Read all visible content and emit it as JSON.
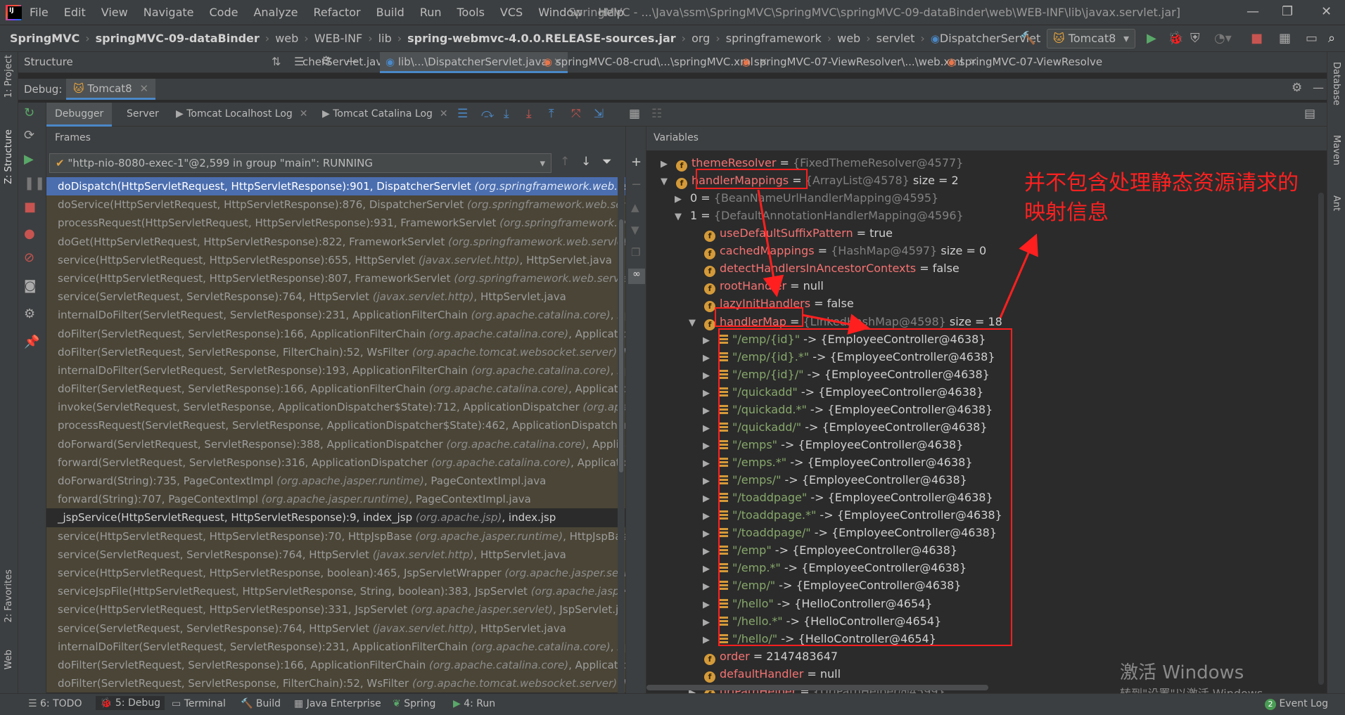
{
  "menu": {
    "items": [
      "File",
      "Edit",
      "View",
      "Navigate",
      "Code",
      "Analyze",
      "Refactor",
      "Build",
      "Run",
      "Tools",
      "VCS",
      "Window",
      "Help"
    ],
    "window_title": "SpringMVC - ...\\Java\\ssm\\SpringMVC\\SpringMVC\\springMVC-09-dataBinder\\web\\WEB-INF\\lib\\javax.servlet.jar]"
  },
  "breadcrumbs": [
    "SpringMVC",
    "springMVC-09-dataBinder",
    "web",
    "WEB-INF",
    "lib",
    "spring-webmvc-4.0.0.RELEASE-sources.jar",
    "org",
    "springframework",
    "web",
    "servlet",
    "DispatcherServlet"
  ],
  "run_config": "Tomcat8",
  "structure_panel": {
    "title": "Structure"
  },
  "editor_tabs": [
    {
      "label": "cherServlet.java",
      "active": false
    },
    {
      "label": "lib\\...\\DispatcherServlet.java",
      "active": true
    },
    {
      "label": "springMVC-08-crud\\...\\springMVC.xml",
      "active": false
    },
    {
      "label": "springMVC-07-ViewResolver\\...\\web.xml",
      "active": false
    },
    {
      "label": "springMVC-07-ViewResolve",
      "active": false
    }
  ],
  "debug": {
    "label": "Debug:",
    "session": "Tomcat8",
    "tabs": [
      "Debugger",
      "Server",
      "Tomcat Localhost Log",
      "Tomcat Catalina Log"
    ],
    "frames_label": "Frames",
    "variables_label": "Variables",
    "thread": "\"http-nio-8080-exec-1\"@2,599 in group \"main\": RUNNING"
  },
  "frames": [
    {
      "m": "doDispatch(HttpServletRequest, HttpServletResponse):901, DispatcherServlet ",
      "p": "(org.springframework.web.servlet)",
      "f": "",
      "kind": "sel"
    },
    {
      "m": "doService(HttpServletRequest, HttpServletResponse):876, DispatcherServlet ",
      "p": "(org.springframework.web.servlet)",
      "f": "",
      "kind": "lib"
    },
    {
      "m": "processRequest(HttpServletRequest, HttpServletResponse):931, FrameworkServlet ",
      "p": "(org.springframework.web.servlet)",
      "f": "",
      "kind": "lib"
    },
    {
      "m": "doGet(HttpServletRequest, HttpServletResponse):822, FrameworkServlet ",
      "p": "(org.springframework.web.servlet)",
      "f": ", F",
      "kind": "lib"
    },
    {
      "m": "service(HttpServletRequest, HttpServletResponse):655, HttpServlet ",
      "p": "(javax.servlet.http)",
      "f": ", HttpServlet.java",
      "kind": "lib"
    },
    {
      "m": "service(HttpServletRequest, HttpServletResponse):807, FrameworkServlet ",
      "p": "(org.springframework.web.servlet)",
      "f": ", F",
      "kind": "lib"
    },
    {
      "m": "service(ServletRequest, ServletResponse):764, HttpServlet ",
      "p": "(javax.servlet.http)",
      "f": ", HttpServlet.java",
      "kind": "lib"
    },
    {
      "m": "internalDoFilter(ServletRequest, ServletResponse):231, ApplicationFilterChain ",
      "p": "(org.apache.catalina.core)",
      "f": ", Appli",
      "kind": "lib"
    },
    {
      "m": "doFilter(ServletRequest, ServletResponse):166, ApplicationFilterChain ",
      "p": "(org.apache.catalina.core)",
      "f": ", ApplicationFil",
      "kind": "lib"
    },
    {
      "m": "doFilter(ServletRequest, ServletResponse, FilterChain):52, WsFilter ",
      "p": "(org.apache.tomcat.websocket.server)",
      "f": ", WsF",
      "kind": "lib"
    },
    {
      "m": "internalDoFilter(ServletRequest, ServletResponse):193, ApplicationFilterChain ",
      "p": "(org.apache.catalina.core)",
      "f": ", Appli",
      "kind": "lib"
    },
    {
      "m": "doFilter(ServletRequest, ServletResponse):166, ApplicationFilterChain ",
      "p": "(org.apache.catalina.core)",
      "f": ", ApplicationFil",
      "kind": "lib"
    },
    {
      "m": "invoke(ServletRequest, ServletResponse, ApplicationDispatcher$State):712, ApplicationDispatcher ",
      "p": "(org.apache",
      "f": "",
      "kind": "lib"
    },
    {
      "m": "processRequest(ServletRequest, ServletResponse, ApplicationDispatcher$State):462, ApplicationDispatcher ",
      "p": "(o",
      "f": "",
      "kind": "lib"
    },
    {
      "m": "doForward(ServletRequest, ServletResponse):388, ApplicationDispatcher ",
      "p": "(org.apache.catalina.core)",
      "f": ", Applicatio",
      "kind": "lib"
    },
    {
      "m": "forward(ServletRequest, ServletResponse):316, ApplicationDispatcher ",
      "p": "(org.apache.catalina.core)",
      "f": ", ApplicationDi",
      "kind": "lib"
    },
    {
      "m": "doForward(String):735, PageContextImpl ",
      "p": "(org.apache.jasper.runtime)",
      "f": ", PageContextImpl.java",
      "kind": "lib"
    },
    {
      "m": "forward(String):707, PageContextImpl ",
      "p": "(org.apache.jasper.runtime)",
      "f": ", PageContextImpl.java",
      "kind": "lib"
    },
    {
      "m": "_jspService(HttpServletRequest, HttpServletResponse):9, index_jsp ",
      "p": "(org.apache.jsp)",
      "f": ", index.jsp",
      "kind": "own"
    },
    {
      "m": "service(HttpServletRequest, HttpServletResponse):70, HttpJspBase ",
      "p": "(org.apache.jasper.runtime)",
      "f": ", HttpJspBase.ja",
      "kind": "lib"
    },
    {
      "m": "service(ServletRequest, ServletResponse):764, HttpServlet ",
      "p": "(javax.servlet.http)",
      "f": ", HttpServlet.java",
      "kind": "lib"
    },
    {
      "m": "service(HttpServletRequest, HttpServletResponse, boolean):465, JspServletWrapper ",
      "p": "(org.apache.jasper.servle",
      "f": "",
      "kind": "lib"
    },
    {
      "m": "serviceJspFile(HttpServletRequest, HttpServletResponse, String, boolean):383, JspServlet ",
      "p": "(org.apache.jasper.se",
      "f": "",
      "kind": "lib"
    },
    {
      "m": "service(HttpServletRequest, HttpServletResponse):331, JspServlet ",
      "p": "(org.apache.jasper.servlet)",
      "f": ", JspServlet.java",
      "kind": "lib"
    },
    {
      "m": "service(ServletRequest, ServletResponse):764, HttpServlet ",
      "p": "(javax.servlet.http)",
      "f": ", HttpServlet.java",
      "kind": "lib"
    },
    {
      "m": "internalDoFilter(ServletRequest, ServletResponse):231, ApplicationFilterChain ",
      "p": "(org.apache.catalina.core)",
      "f": ", Appli",
      "kind": "lib"
    },
    {
      "m": "doFilter(ServletRequest, ServletResponse):166, ApplicationFilterChain ",
      "p": "(org.apache.catalina.core)",
      "f": ", ApplicationFil",
      "kind": "lib"
    },
    {
      "m": "doFilter(ServletRequest, ServletResponse, FilterChain):52, WsFilter ",
      "p": "(org.apache.tomcat.websocket.server)",
      "f": ", WsF",
      "kind": "lib"
    }
  ],
  "variables": [
    {
      "tri": "▶",
      "icon": "f",
      "name": "themeResolver",
      "eq": " = ",
      "val": "{FixedThemeResolver@4577}",
      "extra": "",
      "indent": 0
    },
    {
      "tri": "▼",
      "icon": "f",
      "name": "handlerMappings",
      "eq": " = ",
      "val": "{ArrayList@4578}",
      "extra": "  size = 2",
      "indent": 0
    },
    {
      "tri": "▶",
      "icon": "",
      "name": "0",
      "eq": " = ",
      "val": "{BeanNameUrlHandlerMapping@4595}",
      "extra": "",
      "indent": 1,
      "plainname": true
    },
    {
      "tri": "▼",
      "icon": "",
      "name": "1",
      "eq": " = ",
      "val": "{DefaultAnnotationHandlerMapping@4596}",
      "extra": "",
      "indent": 1,
      "plainname": true
    },
    {
      "tri": "",
      "icon": "f",
      "name": "useDefaultSuffixPattern",
      "eq": " = ",
      "val": "",
      "extra": "true",
      "indent": 2
    },
    {
      "tri": "",
      "icon": "f",
      "name": "cachedMappings",
      "eq": " = ",
      "val": "{HashMap@4597}",
      "extra": "  size = 0",
      "indent": 2
    },
    {
      "tri": "",
      "icon": "f",
      "name": "detectHandlersInAncestorContexts",
      "eq": " = ",
      "val": "",
      "extra": "false",
      "indent": 2
    },
    {
      "tri": "",
      "icon": "f",
      "name": "rootHandler",
      "eq": " = ",
      "val": "",
      "extra": "null",
      "indent": 2
    },
    {
      "tri": "",
      "icon": "f",
      "name": "lazyInitHandlers",
      "eq": " = ",
      "val": "",
      "extra": "false",
      "indent": 2
    },
    {
      "tri": "▼",
      "icon": "f",
      "name": "handlerMap",
      "eq": " = ",
      "val": "{LinkedHashMap@4598}",
      "extra": "  size = 18",
      "indent": 2
    },
    {
      "tri": "▶",
      "icon": "l",
      "name": "\"/emp/{id}\"",
      "eq": " -> ",
      "val": "",
      "extra": "{EmployeeController@4638}",
      "indent": 3,
      "str": true
    },
    {
      "tri": "▶",
      "icon": "l",
      "name": "\"/emp/{id}.*\"",
      "eq": " -> ",
      "val": "",
      "extra": "{EmployeeController@4638}",
      "indent": 3,
      "str": true
    },
    {
      "tri": "▶",
      "icon": "l",
      "name": "\"/emp/{id}/\"",
      "eq": " -> ",
      "val": "",
      "extra": "{EmployeeController@4638}",
      "indent": 3,
      "str": true
    },
    {
      "tri": "▶",
      "icon": "l",
      "name": "\"/quickadd\"",
      "eq": " -> ",
      "val": "",
      "extra": "{EmployeeController@4638}",
      "indent": 3,
      "str": true
    },
    {
      "tri": "▶",
      "icon": "l",
      "name": "\"/quickadd.*\"",
      "eq": " -> ",
      "val": "",
      "extra": "{EmployeeController@4638}",
      "indent": 3,
      "str": true
    },
    {
      "tri": "▶",
      "icon": "l",
      "name": "\"/quickadd/\"",
      "eq": " -> ",
      "val": "",
      "extra": "{EmployeeController@4638}",
      "indent": 3,
      "str": true
    },
    {
      "tri": "▶",
      "icon": "l",
      "name": "\"/emps\"",
      "eq": " -> ",
      "val": "",
      "extra": "{EmployeeController@4638}",
      "indent": 3,
      "str": true
    },
    {
      "tri": "▶",
      "icon": "l",
      "name": "\"/emps.*\"",
      "eq": " -> ",
      "val": "",
      "extra": "{EmployeeController@4638}",
      "indent": 3,
      "str": true
    },
    {
      "tri": "▶",
      "icon": "l",
      "name": "\"/emps/\"",
      "eq": " -> ",
      "val": "",
      "extra": "{EmployeeController@4638}",
      "indent": 3,
      "str": true
    },
    {
      "tri": "▶",
      "icon": "l",
      "name": "\"/toaddpage\"",
      "eq": " -> ",
      "val": "",
      "extra": "{EmployeeController@4638}",
      "indent": 3,
      "str": true
    },
    {
      "tri": "▶",
      "icon": "l",
      "name": "\"/toaddpage.*\"",
      "eq": " -> ",
      "val": "",
      "extra": "{EmployeeController@4638}",
      "indent": 3,
      "str": true
    },
    {
      "tri": "▶",
      "icon": "l",
      "name": "\"/toaddpage/\"",
      "eq": " -> ",
      "val": "",
      "extra": "{EmployeeController@4638}",
      "indent": 3,
      "str": true
    },
    {
      "tri": "▶",
      "icon": "l",
      "name": "\"/emp\"",
      "eq": " -> ",
      "val": "",
      "extra": "{EmployeeController@4638}",
      "indent": 3,
      "str": true
    },
    {
      "tri": "▶",
      "icon": "l",
      "name": "\"/emp.*\"",
      "eq": " -> ",
      "val": "",
      "extra": "{EmployeeController@4638}",
      "indent": 3,
      "str": true
    },
    {
      "tri": "▶",
      "icon": "l",
      "name": "\"/emp/\"",
      "eq": " -> ",
      "val": "",
      "extra": "{EmployeeController@4638}",
      "indent": 3,
      "str": true
    },
    {
      "tri": "▶",
      "icon": "l",
      "name": "\"/hello\"",
      "eq": " -> ",
      "val": "",
      "extra": "{HelloController@4654}",
      "indent": 3,
      "str": true
    },
    {
      "tri": "▶",
      "icon": "l",
      "name": "\"/hello.*\"",
      "eq": " -> ",
      "val": "",
      "extra": "{HelloController@4654}",
      "indent": 3,
      "str": true
    },
    {
      "tri": "▶",
      "icon": "l",
      "name": "\"/hello/\"",
      "eq": " -> ",
      "val": "",
      "extra": "{HelloController@4654}",
      "indent": 3,
      "str": true
    },
    {
      "tri": "",
      "icon": "f",
      "name": "order",
      "eq": " = ",
      "val": "",
      "extra": "2147483647",
      "indent": 2
    },
    {
      "tri": "",
      "icon": "f",
      "name": "defaultHandler",
      "eq": " = ",
      "val": "",
      "extra": "null",
      "indent": 2
    },
    {
      "tri": "▶",
      "icon": "f",
      "name": "urlPathHelper",
      "eq": " = ",
      "val": "{UrlPathHelper@4599}",
      "extra": "",
      "indent": 2
    }
  ],
  "annotation": {
    "line1": "并不包含处理静态资源请求的",
    "line2": "映射信息",
    "color": "#ff2020"
  },
  "watermark": {
    "line1": "激活 Windows",
    "line2": "转到\"设置\"以激活 Windows。"
  },
  "left_tools": [
    "1: Project",
    "Z: Structure",
    "2: Favorites",
    "Web"
  ],
  "right_tools": [
    "Database",
    "Maven",
    "Ant"
  ],
  "status_tabs": [
    "6: TODO",
    "5: Debug",
    "Terminal",
    "Build",
    "Java Enterprise",
    "Spring",
    "4: Run"
  ],
  "event_log": {
    "count": "2",
    "label": "Event Log"
  }
}
